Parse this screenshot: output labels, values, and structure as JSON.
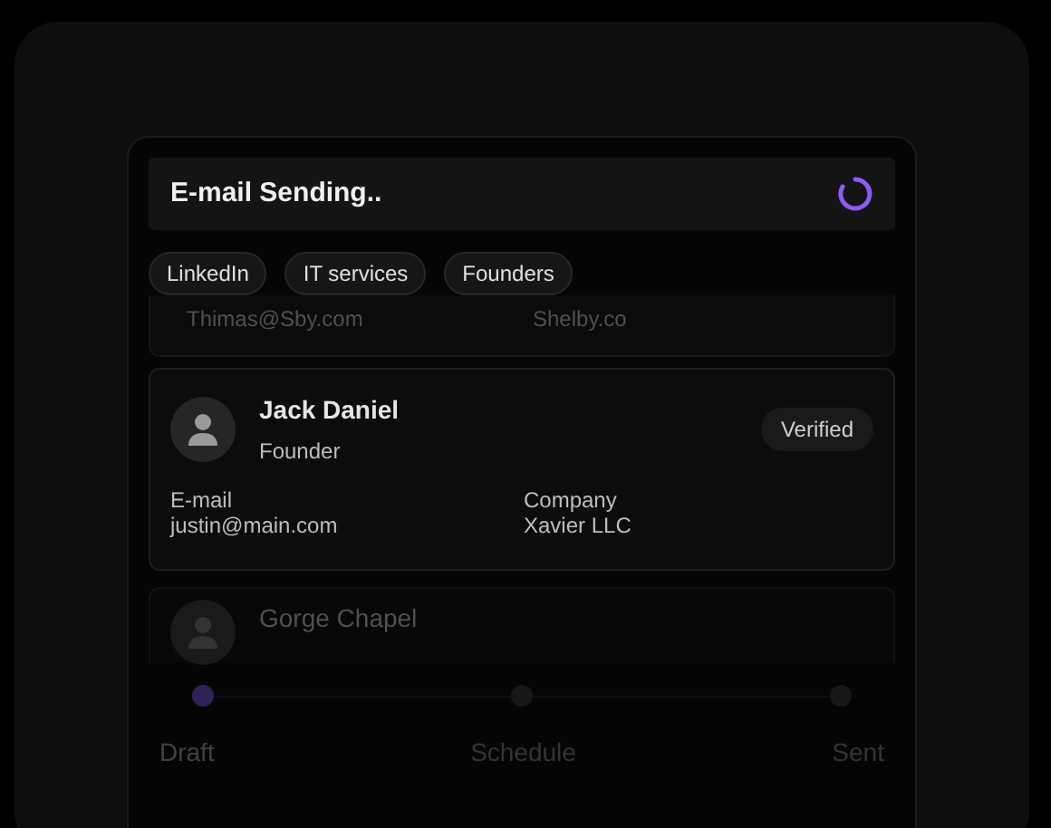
{
  "status": {
    "title": "E-mail Sending.."
  },
  "tags": [
    {
      "label": "LinkedIn"
    },
    {
      "label": "IT services"
    },
    {
      "label": "Founders"
    }
  ],
  "contacts": [
    {
      "kind": "faded-top",
      "email": "Thimas@Sby.com",
      "company": "Shelby.co"
    },
    {
      "kind": "full",
      "name": "Jack Daniel",
      "role": "Founder",
      "badge": "Verified",
      "email_label": "E-mail",
      "email": "justin@main.com",
      "company_label": "Company",
      "company": "Xavier LLC"
    },
    {
      "kind": "faded-bottom",
      "name": "Gorge Chapel"
    }
  ],
  "steps": [
    {
      "label": "Draft",
      "selected": true
    },
    {
      "label": "Schedule",
      "selected": false
    },
    {
      "label": "Sent",
      "selected": false
    }
  ]
}
